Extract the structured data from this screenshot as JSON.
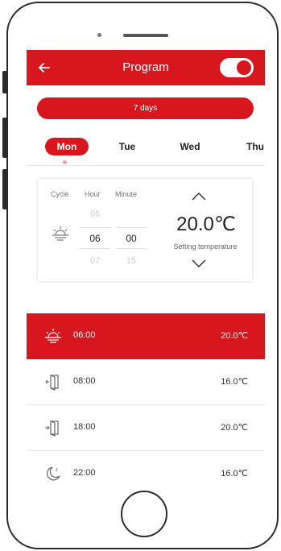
{
  "header": {
    "title": "Program",
    "back_icon": "arrow-left-icon",
    "toggle_on": true
  },
  "mode": {
    "label": "7 days"
  },
  "days": [
    {
      "label": "Mon",
      "active": true
    },
    {
      "label": "Tue",
      "active": false
    },
    {
      "label": "Wed",
      "active": false
    },
    {
      "label": "Thu",
      "active": false
    }
  ],
  "editor": {
    "cycle_label": "Cycle",
    "hour_label": "Hour",
    "minute_label": "Minute",
    "hour_prev": "05",
    "hour_value": "06",
    "hour_next": "07",
    "minute_value": "00",
    "minute_next": "15",
    "temperature": "20.0℃",
    "temperature_label": "Setting temperature",
    "cycle_icon": "sunrise-icon"
  },
  "schedule": [
    {
      "icon": "sunrise-icon",
      "time": "06:00",
      "temp": "20.0℃",
      "active": true
    },
    {
      "icon": "door-leave-icon",
      "time": "08:00",
      "temp": "16.0℃",
      "active": false
    },
    {
      "icon": "door-return-icon",
      "time": "18:00",
      "temp": "20.0℃",
      "active": false
    },
    {
      "icon": "moon-sleep-icon",
      "time": "22:00",
      "temp": "16.0℃",
      "active": false
    }
  ],
  "colors": {
    "accent": "#d7161e",
    "text": "#222222",
    "muted": "#777777",
    "dim": "#cfcfcf"
  }
}
